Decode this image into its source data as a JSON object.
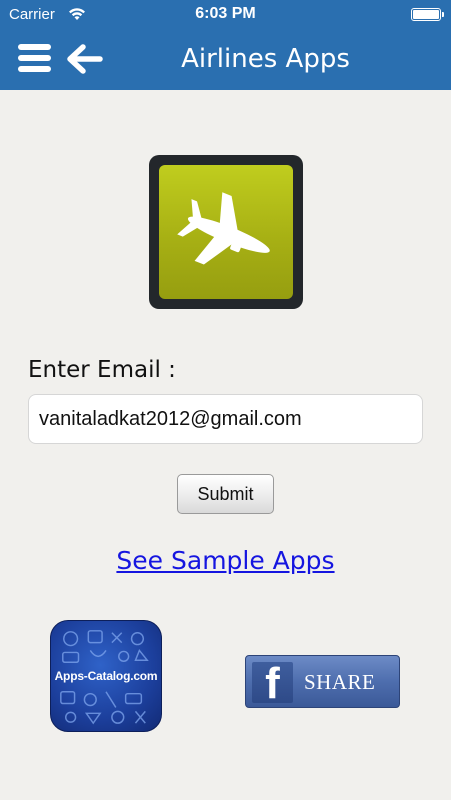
{
  "status_bar": {
    "carrier": "Carrier",
    "time": "6:03 PM",
    "wifi_icon": "wifi-icon",
    "battery_icon": "battery-full-icon"
  },
  "nav": {
    "title": "Airlines Apps",
    "menu_icon": "hamburger-menu-icon",
    "back_icon": "arrow-left-icon",
    "background_color": "#2a6fb0"
  },
  "app_icon": {
    "icon": "airplane-icon",
    "color": "#b2bd17"
  },
  "form": {
    "email_label": "Enter Email :",
    "email_value": "vanitaladkat2012@gmail.com",
    "submit_label": "Submit"
  },
  "links": {
    "sample_apps": "See Sample Apps"
  },
  "footer": {
    "catalog_label": "Apps-Catalog.com",
    "share_label": "SHARE",
    "facebook_icon": "facebook-f-icon",
    "facebook_letter": "f"
  }
}
